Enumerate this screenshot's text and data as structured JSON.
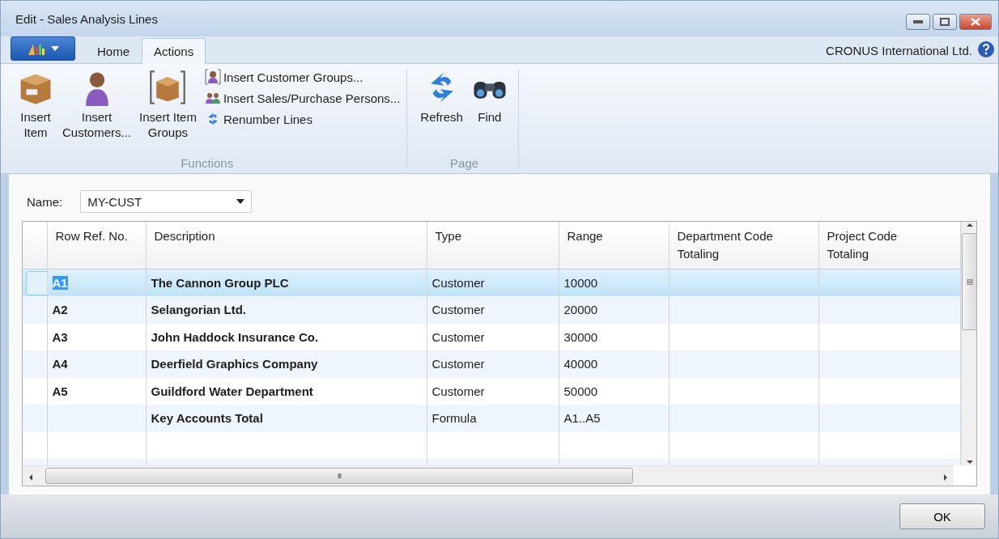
{
  "window": {
    "title": "Edit - Sales Analysis Lines"
  },
  "tabs": [
    {
      "label": "Home",
      "selected": false
    },
    {
      "label": "Actions",
      "selected": true
    }
  ],
  "company": "CRONUS International Ltd.",
  "ribbon_groups": [
    {
      "title": "Functions",
      "large": [
        {
          "label": "Insert\nItem"
        },
        {
          "label": "Insert\nCustomers..."
        },
        {
          "label": "Insert Item\nGroups"
        }
      ],
      "small": [
        {
          "label": "Insert Customer Groups..."
        },
        {
          "label": "Insert Sales/Purchase Persons..."
        },
        {
          "label": "Renumber Lines"
        }
      ]
    },
    {
      "title": "Page",
      "large": [
        {
          "label": "Refresh"
        },
        {
          "label": "Find"
        }
      ]
    }
  ],
  "name_field": {
    "label": "Name:",
    "value": "MY-CUST"
  },
  "table": {
    "columns": [
      "Row Ref. No.",
      "Description",
      "Type",
      "Range",
      "Department Code\nTotaling",
      "Project Code\nTotaling"
    ],
    "rows": [
      {
        "cells": [
          "A1",
          "The Cannon Group PLC",
          "Customer",
          "10000",
          "",
          ""
        ],
        "selected": true
      },
      {
        "cells": [
          "A2",
          "Selangorian Ltd.",
          "Customer",
          "20000",
          "",
          ""
        ],
        "selected": false
      },
      {
        "cells": [
          "A3",
          "John Haddock Insurance Co.",
          "Customer",
          "30000",
          "",
          ""
        ],
        "selected": false
      },
      {
        "cells": [
          "A4",
          "Deerfield Graphics Company",
          "Customer",
          "40000",
          "",
          ""
        ],
        "selected": false
      },
      {
        "cells": [
          "A5",
          "Guildford Water Department",
          "Customer",
          "50000",
          "",
          ""
        ],
        "selected": false
      },
      {
        "cells": [
          "",
          "Key Accounts Total",
          "Formula",
          "A1..A5",
          "",
          ""
        ],
        "selected": false
      }
    ]
  },
  "scroll_thumb_glyph": "III",
  "buttons": [
    "OK"
  ]
}
